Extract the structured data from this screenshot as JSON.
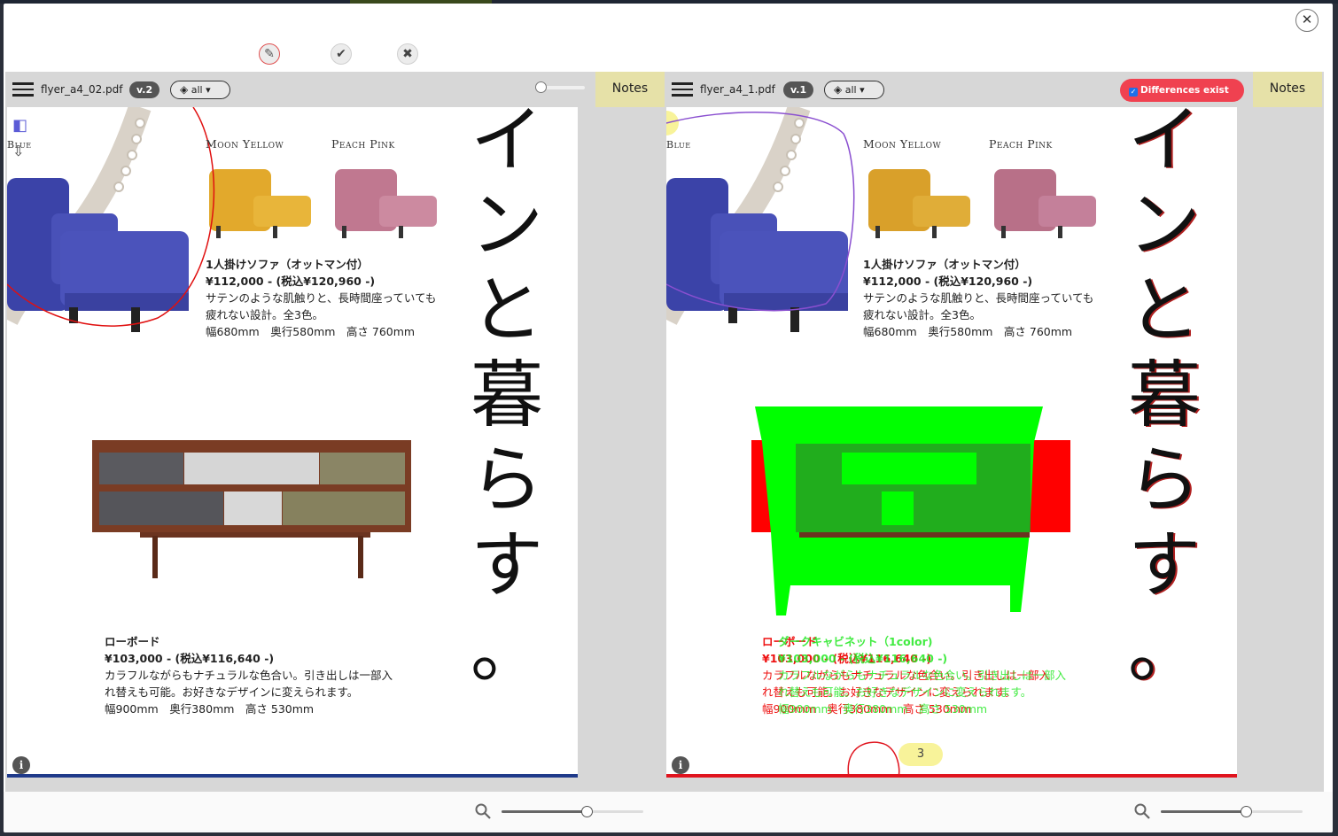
{
  "toolbar_actions": {
    "edit": "✎",
    "approve": "✔",
    "reject": "✖",
    "close": "✕"
  },
  "left": {
    "filename": "flyer_a4_02.pdf",
    "version": "v.2",
    "layers": "all",
    "notes": "Notes"
  },
  "right": {
    "filename": "flyer_a4_1.pdf",
    "version": "v.1",
    "layers": "all",
    "notes": "Notes",
    "diff_badge": "Differences exist",
    "page_number": "3"
  },
  "content": {
    "color_labels": [
      "Moon Yellow",
      "Peach Pink"
    ],
    "blue_label": "Blue",
    "sofa_title": "1人掛けソファ（オットマン付）",
    "sofa_price": "¥112,000 - (税込¥120,960 -)",
    "sofa_desc1": "サテンのような肌触りと、長時間座っていても",
    "sofa_desc2": "疲れない設計。全3色。",
    "sofa_dims": "幅680mm　奥行580mm　高さ 760mm",
    "board_title": "ローボード",
    "board_price": "¥103,000 - (税込¥116,640 -)",
    "board_desc1": "カラフルながらもナチュラルな色合い。引き出しは一部入",
    "board_desc2": "れ替えも可能。お好きなデザインに変えられます。",
    "board_dims": "幅900mm　奥行380mm　高さ 530mm",
    "right_board_title": "ローボード",
    "right_board_title_alt": "ダークキャビネット（1color)",
    "vertical_text": [
      "イ",
      "ン",
      "と",
      "暮",
      "ら",
      "す",
      "。"
    ]
  },
  "colors": {
    "left_rule": "#1f3a8a",
    "right_rule": "#e0141e",
    "diff_green": "#00ff00",
    "diff_red": "#ff0000",
    "markup_left": "#e01010",
    "markup_right": "#8a4fd0"
  }
}
